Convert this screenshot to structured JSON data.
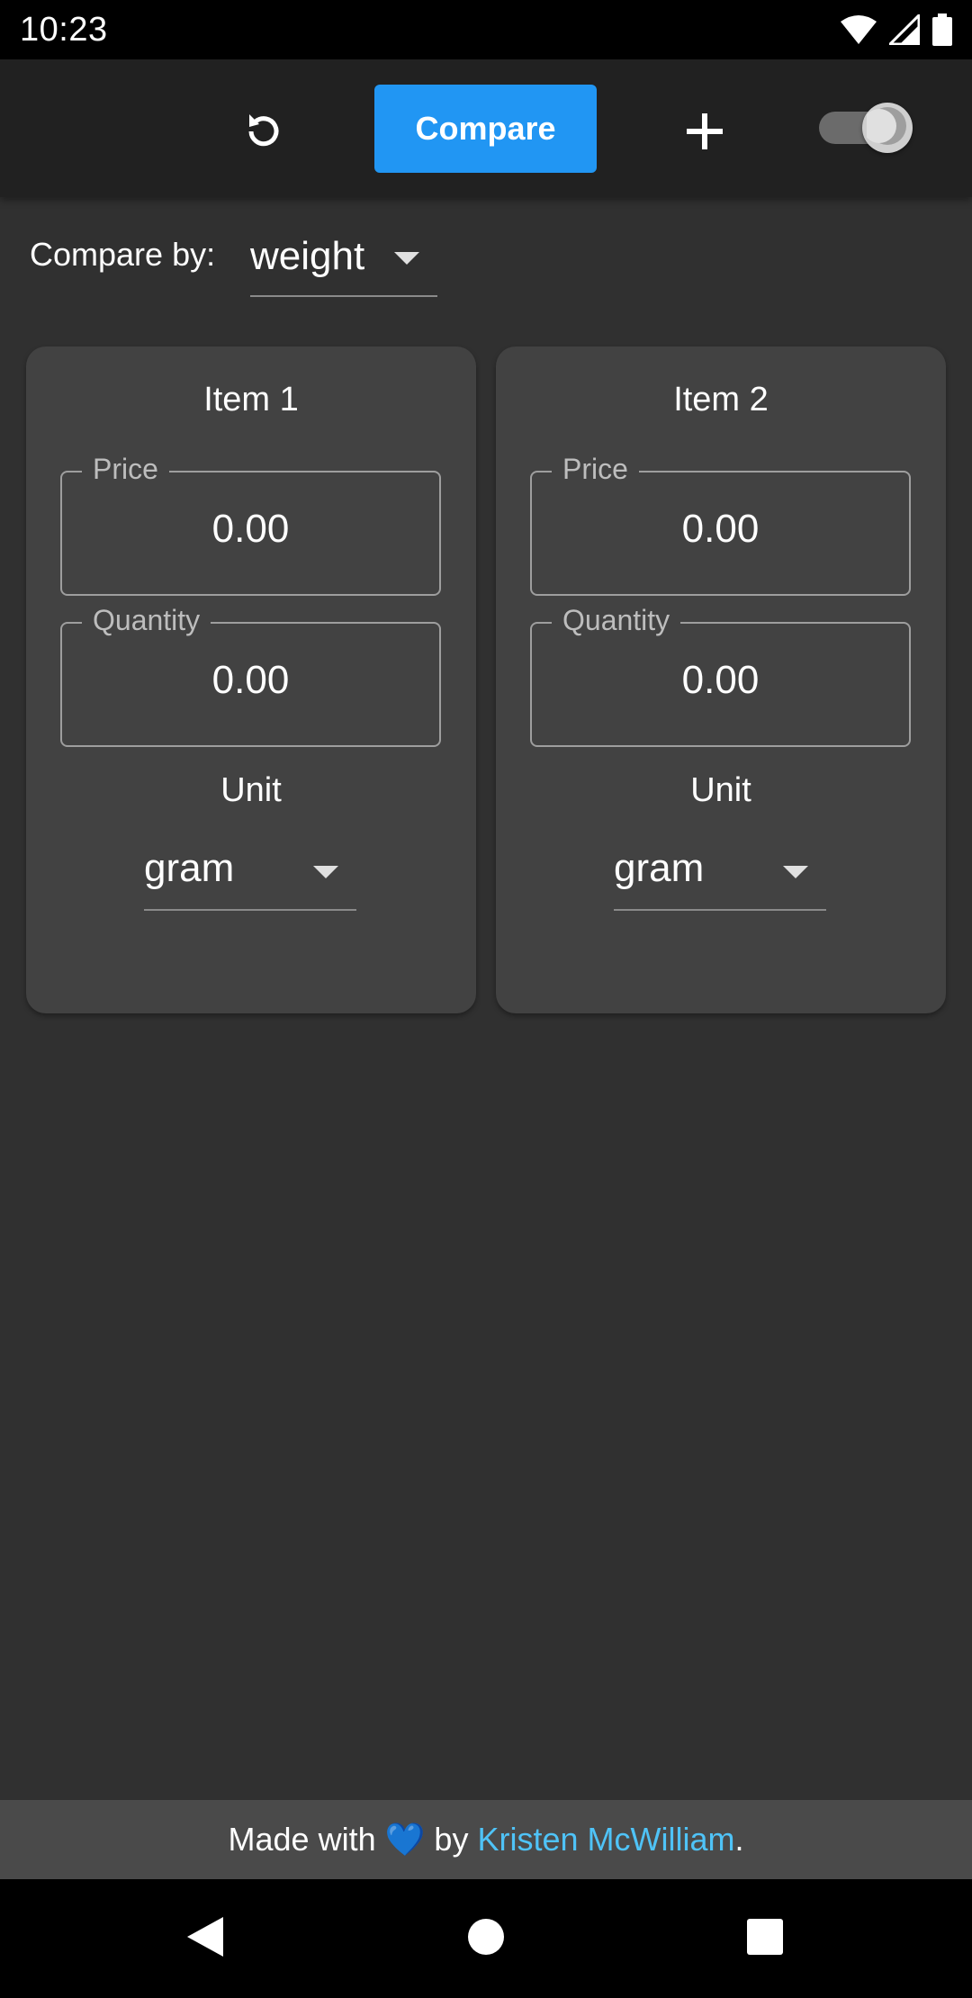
{
  "status_bar": {
    "time": "10:23",
    "icons": [
      "wifi-icon",
      "signal-icon",
      "battery-icon"
    ]
  },
  "app_bar": {
    "reset_icon": "refresh-icon",
    "compare_label": "Compare",
    "add_icon": "plus-icon",
    "theme_toggle": {
      "state": "on",
      "icon": "moon-icon"
    }
  },
  "compare_by": {
    "label": "Compare by:",
    "selected": "weight"
  },
  "items": [
    {
      "title": "Item 1",
      "price": {
        "label": "Price",
        "value": "0.00"
      },
      "quantity": {
        "label": "Quantity",
        "value": "0.00"
      },
      "unit": {
        "label": "Unit",
        "selected": "gram"
      }
    },
    {
      "title": "Item 2",
      "price": {
        "label": "Price",
        "value": "0.00"
      },
      "quantity": {
        "label": "Quantity",
        "value": "0.00"
      },
      "unit": {
        "label": "Unit",
        "selected": "gram"
      }
    }
  ],
  "footer": {
    "prefix": "Made with",
    "heart": "💙",
    "by": "by",
    "author": "Kristen McWilliam",
    "suffix": "."
  },
  "nav_bar": {
    "icons": [
      "back-icon",
      "home-icon",
      "recents-icon"
    ]
  },
  "colors": {
    "background": "#303030",
    "app_bar": "#212121",
    "card": "#424242",
    "accent": "#2196f3",
    "link": "#4fc3f7"
  }
}
